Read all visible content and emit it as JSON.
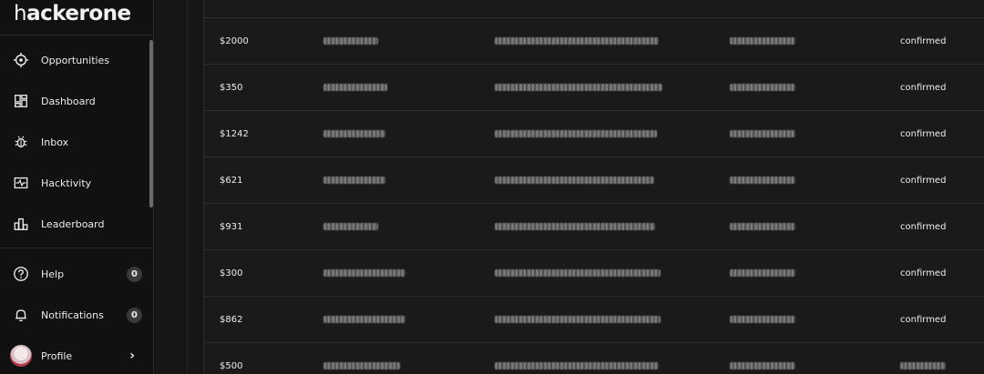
{
  "brand": {
    "logo_light": "h",
    "logo_bold": "acker",
    "logo_rest": "one"
  },
  "sidebar": {
    "nav": [
      {
        "label": "Opportunities",
        "icon": "target-icon"
      },
      {
        "label": "Dashboard",
        "icon": "dashboard-icon"
      },
      {
        "label": "Inbox",
        "icon": "bug-icon"
      },
      {
        "label": "Hacktivity",
        "icon": "activity-icon"
      },
      {
        "label": "Leaderboard",
        "icon": "leaderboard-icon"
      }
    ],
    "help": {
      "label": "Help",
      "count": "0",
      "icon": "help-icon"
    },
    "notifications": {
      "label": "Notifications",
      "count": "0",
      "icon": "bell-icon"
    },
    "profile": {
      "label": "Profile",
      "chevron": "›"
    }
  },
  "table": {
    "rows": [
      {
        "amount": "$2000",
        "status": "confirmed"
      },
      {
        "amount": "$350",
        "status": "confirmed"
      },
      {
        "amount": "$1242",
        "status": "confirmed"
      },
      {
        "amount": "$621",
        "status": "confirmed"
      },
      {
        "amount": "$931",
        "status": "confirmed"
      },
      {
        "amount": "$300",
        "status": "confirmed"
      },
      {
        "amount": "$862",
        "status": "confirmed"
      },
      {
        "amount": "$500",
        "status": ""
      }
    ]
  }
}
